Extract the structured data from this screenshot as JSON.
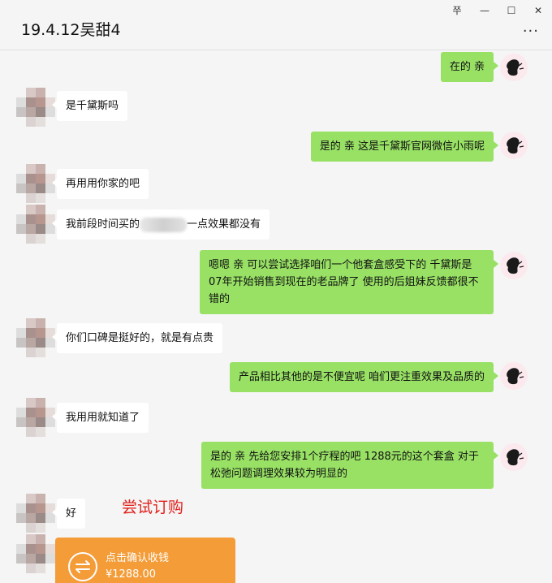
{
  "window": {
    "title": "19.4.12吴甜4",
    "pin_glyph": "쭈",
    "minimize_glyph": "—",
    "maximize_glyph": "☐",
    "close_glyph": "✕",
    "more_glyph": "···"
  },
  "messages": [
    {
      "side": "out",
      "text": "在的 亲"
    },
    {
      "side": "in",
      "text": "是千黛斯吗"
    },
    {
      "side": "out",
      "text": "是的 亲 这是千黛斯官网微信小雨呢"
    },
    {
      "side": "in",
      "text": "再用用你家的吧"
    },
    {
      "side": "in",
      "text_before": "我前段时间买的",
      "text_after": "一点效果都没有"
    },
    {
      "side": "out",
      "text": "嗯嗯  亲  可以尝试选择咱们一个他套盒感受下的  千黛斯是07年开始销售到现在的老品牌了  使用的后姐妹反馈都很不错的"
    },
    {
      "side": "in",
      "text": "你们口碑是挺好的，就是有点贵"
    },
    {
      "side": "out",
      "text": "产品相比其他的是不便宜呢  咱们更注重效果及品质的"
    },
    {
      "side": "in",
      "text": "我用用就知道了"
    },
    {
      "side": "out",
      "text": "是的 亲  先给您安排1个疗程的吧  1288元的这个套盒  对于松弛问题调理效果较为明显的"
    },
    {
      "side": "in",
      "text": "好"
    }
  ],
  "annotation": "尝试订购",
  "transfer": {
    "label": "点击确认收钱",
    "amount": "¥1288.00"
  },
  "colors": {
    "outgoing_bubble": "#98e165",
    "incoming_bubble": "#ffffff",
    "transfer_card": "#f39c38",
    "annotation": "#e0201a"
  }
}
